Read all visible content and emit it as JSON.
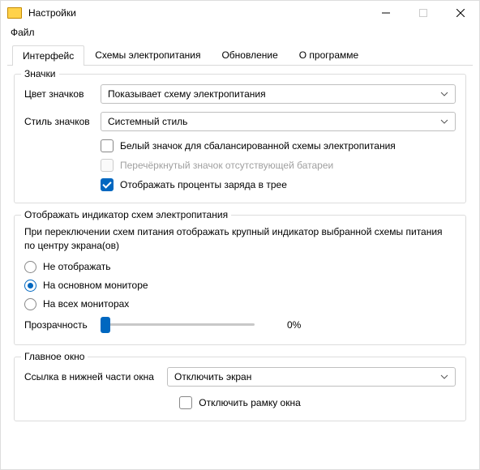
{
  "window": {
    "title": "Настройки"
  },
  "menu": {
    "file": "Файл"
  },
  "tabs": {
    "interface": "Интерфейс",
    "power_plans": "Схемы электропитания",
    "update": "Обновление",
    "about": "О программе"
  },
  "icons_group": {
    "legend": "Значки",
    "color_label": "Цвет значков",
    "color_value": "Показывает схему электропитания",
    "style_label": "Стиль значков",
    "style_value": "Системный стиль",
    "white_icon": "Белый значок для сбалансированной схемы электропитания",
    "striked_battery": "Перечёркнутый значок отсутствующей батареи",
    "show_percent": "Отображать проценты заряда в трее"
  },
  "indicator_group": {
    "legend": "Отображать индикатор схем электропитания",
    "desc": "При переключении схем питания отображать крупный индикатор выбранной схемы питания по центру экрана(ов)",
    "opt_none": "Не отображать",
    "opt_primary": "На основном мониторе",
    "opt_all": "На всех мониторах",
    "opacity_label": "Прозрачность",
    "opacity_value": "0%"
  },
  "mainwin_group": {
    "legend": "Главное окно",
    "link_label": "Ссылка в нижней части окна",
    "link_value": "Отключить экран",
    "disable_frame": "Отключить рамку окна"
  }
}
